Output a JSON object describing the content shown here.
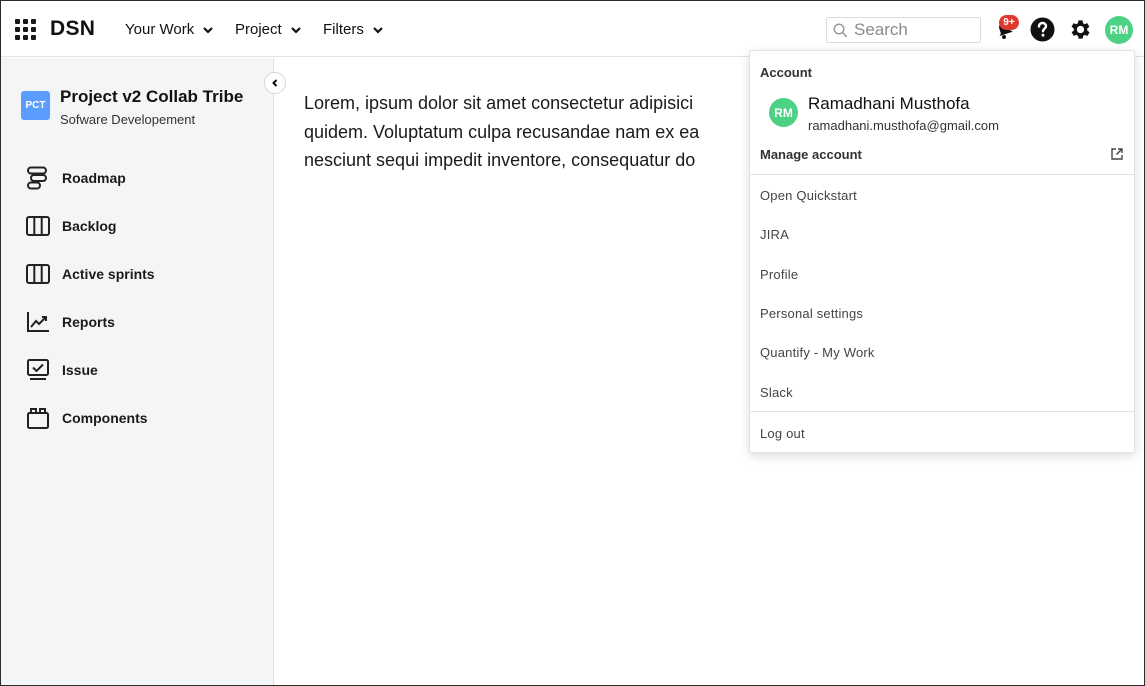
{
  "header": {
    "brand": "DSN",
    "nav": [
      {
        "label": "Your Work"
      },
      {
        "label": "Project"
      },
      {
        "label": "Filters"
      }
    ],
    "search_placeholder": "Search",
    "notification_badge": "9+",
    "user_initials": "RM"
  },
  "sidebar": {
    "project_logo": "PCT",
    "project_name": "Project v2 Collab Tribe",
    "project_subtitle": "Sofware Developement",
    "items": [
      {
        "label": "Roadmap",
        "icon": "roadmap-icon"
      },
      {
        "label": "Backlog",
        "icon": "columns-icon"
      },
      {
        "label": "Active sprints",
        "icon": "columns-icon"
      },
      {
        "label": "Reports",
        "icon": "chart-line-icon"
      },
      {
        "label": "Issue",
        "icon": "monitor-check-icon"
      },
      {
        "label": "Components",
        "icon": "box-icon"
      }
    ]
  },
  "main": {
    "line1": "Lorem, ipsum dolor sit amet consectetur adipisici",
    "line2": "quidem. Voluptatum culpa recusandae nam ex ea",
    "line3": "nesciunt sequi impedit inventore, consequatur do"
  },
  "account_menu": {
    "heading": "Account",
    "user_initials": "RM",
    "user_name": "Ramadhani Musthofa",
    "user_email": "ramadhani.musthofa@gmail.com",
    "manage_label": "Manage account",
    "items": [
      {
        "label": "Open Quickstart"
      },
      {
        "label": "JIRA"
      },
      {
        "label": "Profile"
      },
      {
        "label": "Personal settings"
      },
      {
        "label": "Quantify - My Work"
      },
      {
        "label": "Slack"
      }
    ],
    "logout_label": "Log out"
  },
  "colors": {
    "avatar": "#4cd185",
    "project_logo": "#5b9dff",
    "badge": "#e03a2f",
    "sidebar_bg": "#f4f5f7"
  }
}
